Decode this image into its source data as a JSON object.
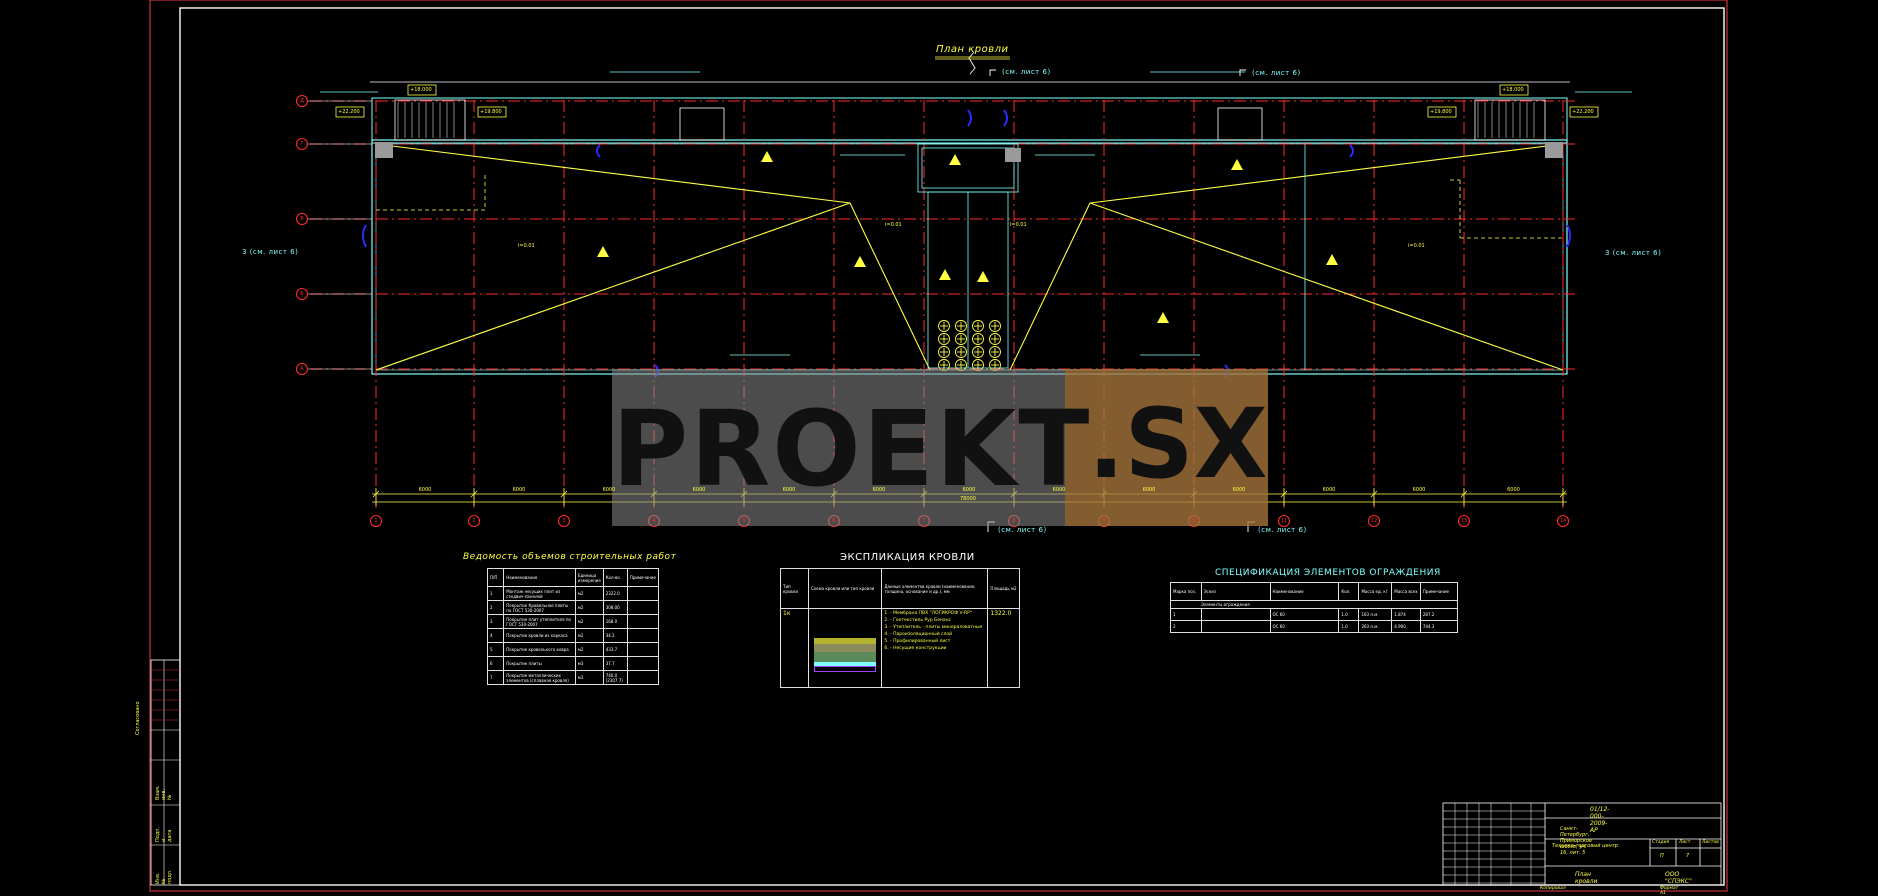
{
  "drawing": {
    "title": "План кровли",
    "refs": {
      "sheet6_top_left": "(см. лист 6)",
      "sheet6_top_right": "(см. лист 6)",
      "sheet6_bottom_left": "(см. лист 6)",
      "sheet6_bottom_right": "(см. лист 6)",
      "left_side": "3 (см. лист 6)",
      "right_side": "3 (см. лист 6)"
    },
    "axis_rows": [
      "А",
      "Б",
      "В",
      "Г",
      "Д"
    ],
    "axis_cols": [
      "1",
      "2",
      "3",
      "4",
      "5",
      "6",
      "7",
      "8",
      "9",
      "10",
      "11",
      "12",
      "13",
      "14"
    ],
    "dimensions": [
      "6000",
      "6000",
      "6000",
      "6000",
      "6000",
      "6000",
      "6000",
      "6000",
      "6000",
      "6000",
      "6000",
      "6000",
      "6000"
    ],
    "total_dimension": "78000",
    "level_marks": [
      "+18.000",
      "+19.800",
      "+22.200",
      "+18.000",
      "+19.800",
      "+22.200"
    ],
    "slope_labels": [
      "i=0.01",
      "i=0.01",
      "i=0.01",
      "i=0.01"
    ]
  },
  "watermark": {
    "text_main": "PROEKT",
    "text_suffix": ".SX"
  },
  "works_table": {
    "title": "Ведомость объемов строительных работ",
    "headers": [
      "П/П",
      "Наименование",
      "Единица измерения",
      "Кол-во",
      "Примечание"
    ],
    "rows": [
      [
        "1",
        "Монтаж несущих плит из сэндвич-панелей",
        "м2",
        "2322.0",
        ""
      ],
      [
        "2",
        "Покрытие Кровельное плиты по ГОСТ 530-2007",
        "м2",
        "308.00",
        ""
      ],
      [
        "3",
        "Покрытие плит утеплителя по ГОСТ 530-2007",
        "м2",
        "168.0",
        ""
      ],
      [
        "4",
        "Покрытие кровли из каркаса",
        "м2",
        "34.2",
        ""
      ],
      [
        "5",
        "Покрытие кровельного ковра",
        "м2",
        "433.7",
        ""
      ],
      [
        "6",
        "Покрытие плиты",
        "м3",
        "37.7",
        ""
      ],
      [
        "7",
        "Покрытие металлических элементов (сплавная кровля)",
        "м3",
        "740.0 (2307.7)",
        ""
      ]
    ]
  },
  "roof_table": {
    "title": "ЭКСПЛИКАЦИЯ КРОВЛИ",
    "headers": [
      "Тип кровли",
      "Схема кровли или тип кровли",
      "Данные элементов кровли (наименование, толщина, основание и др.), мм",
      "Площадь м2"
    ],
    "type": "1к",
    "area": "1322.0",
    "layers": [
      "1. - Мембрана ПВХ \"ЛОГИКРОФ V-RP\"",
      "2. - Геотекстиль Рур Бенанс",
      "3. - Утеплитель - плиты минераловатные",
      "4. - Пароизоляционный слой",
      "5. - Профилированный лист",
      "6. - Несущие конструкции"
    ]
  },
  "fence_table": {
    "title": "СПЕЦИФИКАЦИЯ ЭЛЕМЕНТОВ ОГРАЖДЕНИЯ",
    "headers": [
      "Марка поз.",
      "Эскиз",
      "Наименование",
      "Кол.",
      "Масса ед. кг",
      "Масса всех",
      "Примечание"
    ],
    "group": "Элементы ограждения",
    "rows": [
      [
        "1",
        "",
        "ОС 60",
        "1.0",
        "163 п.м.",
        "1.874",
        "287.2"
      ],
      [
        "2",
        "",
        "ОС 60",
        "1.0",
        "263 п.м.",
        "4.900",
        "744.3"
      ]
    ]
  },
  "title_block": {
    "code": "01/12-000-2009-АР",
    "address": "Санкт-Петербург, Приморское шоссе, уч. 16, лит. 5",
    "object": "Технико-торговый центр",
    "stage_header": "Стадия",
    "sheet_header": "Лист",
    "sheets_header": "Листов",
    "stage": "П",
    "sheet": "7",
    "drawing_name": "План кровли",
    "company": "ООО \"СПЭКС\"",
    "copied": "Копировал",
    "format": "Формат А1"
  },
  "stamp": {
    "label": "Согласовано",
    "rows": [
      "Взам. инв. №",
      "Подп. и дата",
      "Инв. № подл."
    ]
  },
  "colors": {
    "frame": "#ffffff",
    "outer_frame": "#c8323c",
    "axis": "#ff2a2a",
    "outline": "#7fffff",
    "accent_yellow": "#ffff44",
    "wall": "#2a2aff",
    "watermark_bg": "#8a8a8a",
    "watermark_accent": "#b06b1a"
  }
}
